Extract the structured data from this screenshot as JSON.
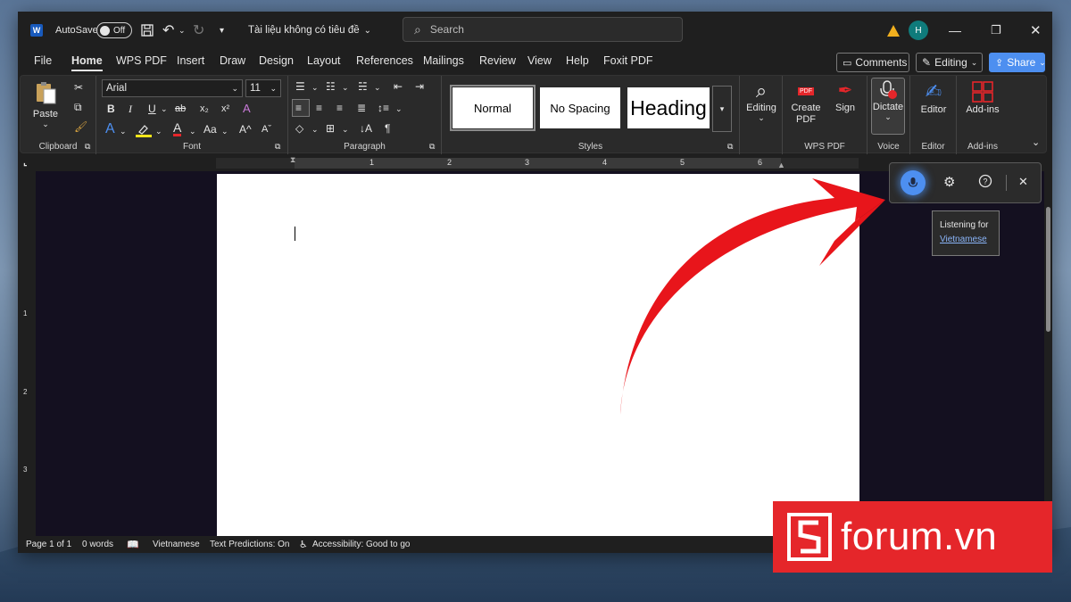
{
  "titlebar": {
    "app_icon": "W",
    "autosave_label": "AutoSave",
    "autosave_state": "Off",
    "doc_title": "Tài liệu không có tiêu đề",
    "search_placeholder": "Search",
    "avatar_initial": "H"
  },
  "menu": {
    "tabs": [
      "File",
      "Home",
      "WPS PDF",
      "Insert",
      "Draw",
      "Design",
      "Layout",
      "References",
      "Mailings",
      "Review",
      "View",
      "Help",
      "Foxit PDF"
    ],
    "active_tab": "Home",
    "comments_label": "Comments",
    "editing_label": "Editing",
    "share_label": "Share"
  },
  "ribbon": {
    "clipboard": {
      "paste_label": "Paste",
      "group_label": "Clipboard"
    },
    "font": {
      "family": "Arial",
      "size": "11",
      "group_label": "Font",
      "case_label": "Aa"
    },
    "paragraph": {
      "group_label": "Paragraph"
    },
    "styles": {
      "normal": "Normal",
      "no_spacing": "No Spacing",
      "heading": "Heading",
      "group_label": "Styles"
    },
    "editing": {
      "label": "Editing"
    },
    "wps_pdf": {
      "create_pdf": "Create PDF",
      "sign": "Sign",
      "group_label": "WPS PDF",
      "pdf_badge": "PDF"
    },
    "voice": {
      "dictate_label": "Dictate",
      "group_label": "Voice"
    },
    "editor": {
      "label": "Editor",
      "group_label": "Editor"
    },
    "addins": {
      "label": "Add-ins",
      "group_label": "Add-ins"
    }
  },
  "ruler": {
    "numbers": [
      "1",
      "2",
      "3",
      "4",
      "5",
      "6"
    ]
  },
  "vruler": {
    "numbers": [
      "1",
      "2",
      "3"
    ]
  },
  "statusbar": {
    "page": "Page 1 of 1",
    "words": "0 words",
    "language": "Vietnamese",
    "predictions": "Text Predictions: On",
    "accessibility": "Accessibility: Good to go"
  },
  "dictation": {
    "listening_label": "Listening for",
    "language": "Vietnamese"
  },
  "brand": {
    "text": "forum.vn"
  },
  "colors": {
    "accent": "#4d8ff0",
    "arrow": "#e8151b",
    "brand": "#e5262a",
    "avatar": "#0f7b7b"
  }
}
